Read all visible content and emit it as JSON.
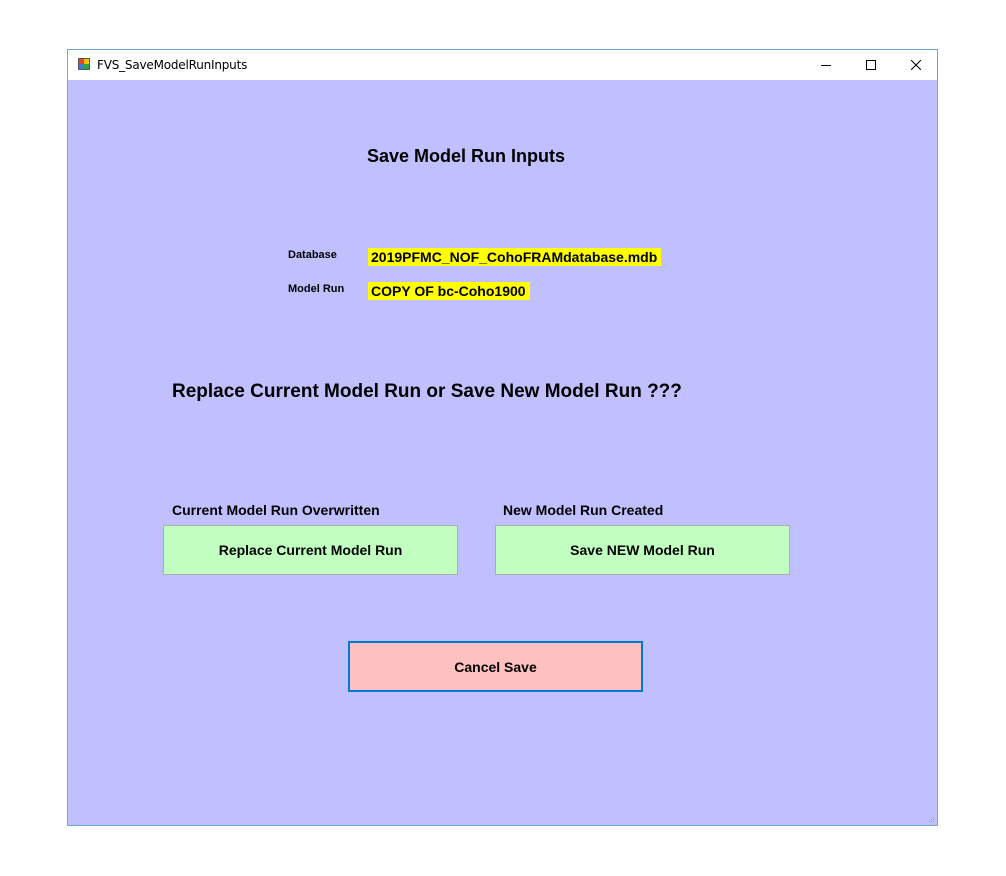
{
  "window": {
    "title": "FVS_SaveModelRunInputs",
    "controls": {
      "minimize_icon": "minimize-icon",
      "maximize_icon": "maximize-icon",
      "close_icon": "close-icon"
    },
    "background_color": "#c0c0ff"
  },
  "form": {
    "heading": "Save Model Run Inputs",
    "database": {
      "label": "Database",
      "value": "2019PFMC_NOF_CohoFRAMdatabase.mdb"
    },
    "model_run": {
      "label": "Model Run",
      "value": "COPY OF bc-Coho1900"
    },
    "question": "Replace Current Model Run or Save New Model Run ???",
    "replace": {
      "caption": "Current Model Run Overwritten",
      "button_label": "Replace Current Model Run"
    },
    "save_new": {
      "caption": "New Model Run Created",
      "button_label": "Save NEW Model Run"
    },
    "cancel": {
      "button_label": "Cancel Save"
    }
  },
  "colors": {
    "highlight": "#ffff00",
    "action_button": "#c0ffc0",
    "cancel_button": "#ffc0c0",
    "focus_border": "#0078d7"
  }
}
